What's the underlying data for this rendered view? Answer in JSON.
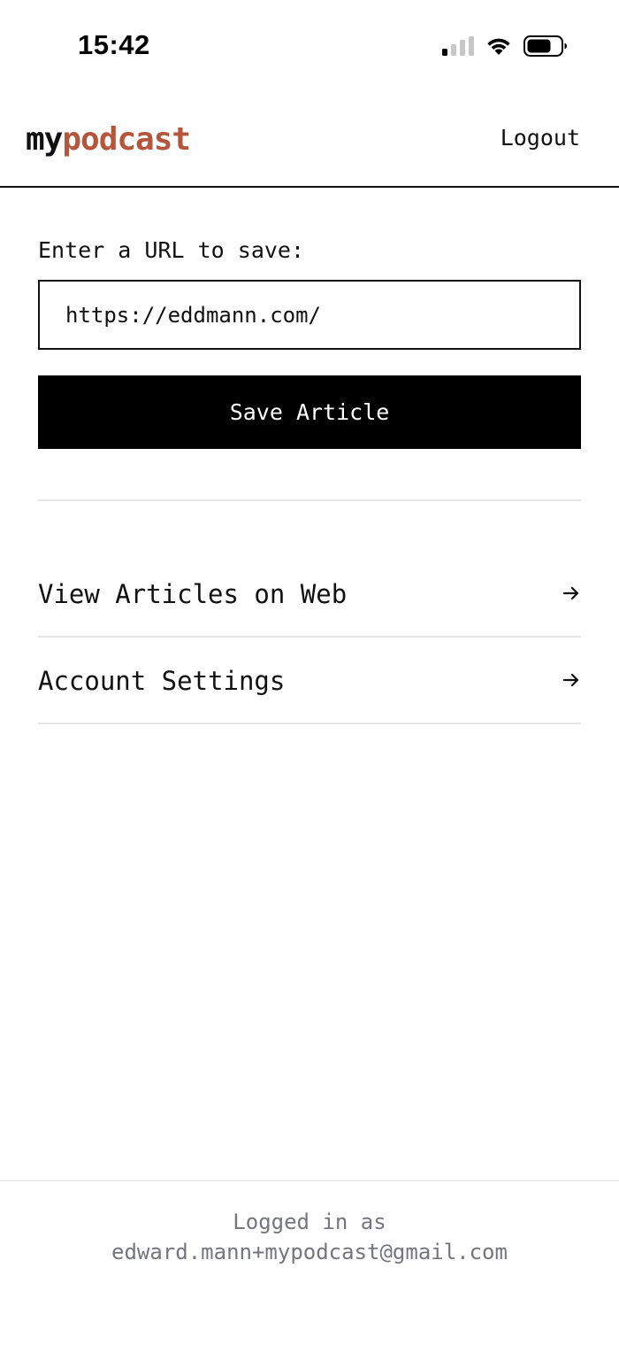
{
  "status_bar": {
    "time": "15:42"
  },
  "header": {
    "logo_prefix": "my",
    "logo_suffix": "podcast",
    "logout_label": "Logout"
  },
  "form": {
    "url_label": "Enter a URL to save:",
    "url_value": "https://eddmann.com/",
    "save_label": "Save Article"
  },
  "nav": {
    "items": [
      {
        "label": "View Articles on Web",
        "icon": "arrow-right-icon"
      },
      {
        "label": "Account Settings",
        "icon": "arrow-right-icon"
      }
    ]
  },
  "footer": {
    "logged_in_label": "Logged in as",
    "email": "edward.mann+mypodcast@gmail.com"
  },
  "colors": {
    "brand_accent": "#b5553c",
    "primary_button": "#000000",
    "divider": "#e6e6e6",
    "muted_text": "#74757d"
  }
}
